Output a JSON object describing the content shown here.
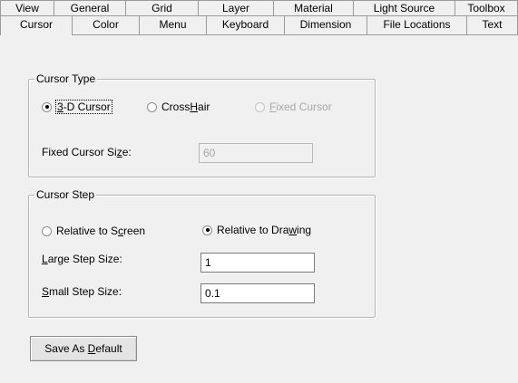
{
  "tabs_back": [
    "View",
    "General",
    "Grid",
    "Layer",
    "Material",
    "Light Source",
    "Toolbox"
  ],
  "tabs_front": [
    "Cursor",
    "Color",
    "Menu",
    "Keyboard",
    "Dimension",
    "File Locations",
    "Text"
  ],
  "active_tab": "Cursor",
  "cursor_type": {
    "legend": "Cursor Type",
    "options": [
      {
        "pre": "",
        "accel": "3",
        "post": "-D Cursor",
        "checked": true,
        "disabled": false
      },
      {
        "pre": "Cross",
        "accel": "H",
        "post": "air",
        "checked": false,
        "disabled": false
      },
      {
        "pre": "",
        "accel": "F",
        "post": "ixed Cursor",
        "checked": false,
        "disabled": true
      }
    ],
    "fixed_size_label_pre": "Fixed Cursor Si",
    "fixed_size_label_accel": "z",
    "fixed_size_label_post": "e:",
    "fixed_size_value": "60"
  },
  "cursor_step": {
    "legend": "Cursor Step",
    "relative_screen": {
      "pre": "Relative to S",
      "accel": "c",
      "post": "reen",
      "checked": false
    },
    "relative_drawing": {
      "pre": "Relative to Dra",
      "accel": "w",
      "post": "ing",
      "checked": true
    },
    "large_label_accel": "L",
    "large_label_post": "arge Step Size:",
    "large_value": "1",
    "small_label_accel": "S",
    "small_label_post": "mall Step Size:",
    "small_value": "0.1"
  },
  "save_button": {
    "pre": "Save As ",
    "accel": "D",
    "post": "efault"
  }
}
